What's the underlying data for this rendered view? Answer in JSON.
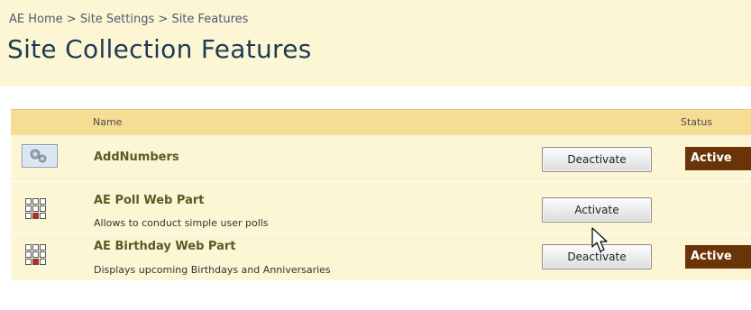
{
  "breadcrumb": {
    "items": [
      "AE Home",
      "Site Settings",
      "Site Features"
    ],
    "separator": ">"
  },
  "page_title": "Site Collection Features",
  "table": {
    "headers": {
      "name": "Name",
      "status": "Status"
    },
    "rows": [
      {
        "name": "AddNumbers",
        "description": "",
        "icon": "generic-feature-icon",
        "button": "Deactivate",
        "status": "Active"
      },
      {
        "name": "AE Poll Web Part",
        "description": "Allows to conduct simple user polls",
        "icon": "web-part-icon",
        "button": "Activate",
        "status": ""
      },
      {
        "name": "AE Birthday Web Part",
        "description": "Displays upcoming Birthdays and Anniversaries",
        "icon": "web-part-icon",
        "button": "Deactivate",
        "status": "Active"
      }
    ]
  },
  "colors": {
    "title_background": "#fcf6d4",
    "header_background": "#f5dd94",
    "active_badge": "#6b3408",
    "title_text": "#1d3b52"
  }
}
